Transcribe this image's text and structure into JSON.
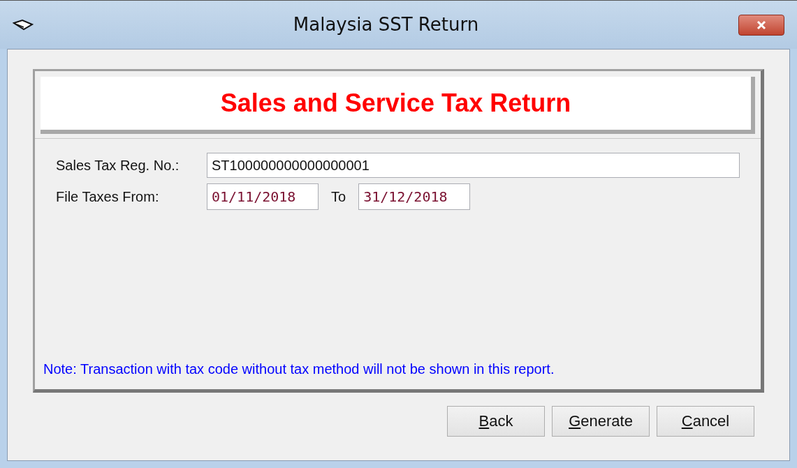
{
  "window": {
    "title": "Malaysia SST Return"
  },
  "header": {
    "title": "Sales and Service Tax Return"
  },
  "form": {
    "fields": [
      {
        "label": "Sales Tax Reg. No.:",
        "kind": "text",
        "value": "ST100000000000000001"
      },
      {
        "label": "File Taxes From:",
        "kind": "range",
        "value": "01/11/2018",
        "separator": "To",
        "value_to": "31/12/2018"
      }
    ]
  },
  "note": "Note: Transaction with tax code without tax method will not be shown in this report.",
  "buttons": [
    {
      "label": "Back",
      "underline_first": true
    },
    {
      "label": "Generate",
      "underline_first": true
    },
    {
      "label": "Cancel",
      "underline_first": true
    }
  ]
}
